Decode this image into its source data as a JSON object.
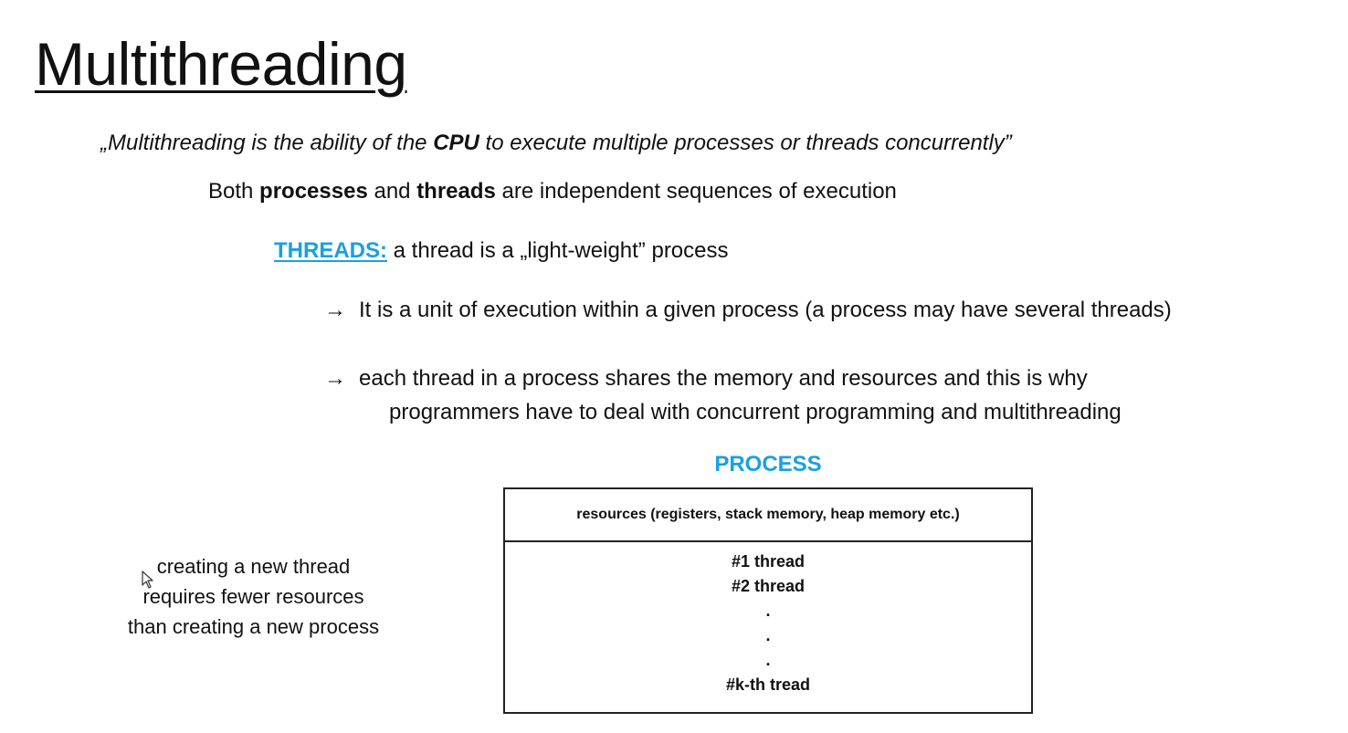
{
  "slide": {
    "title": "Multithreading",
    "quote": {
      "before": "„Multithreading is the ability of the ",
      "bold": "CPU",
      "after": " to execute multiple processes or threads concurrently”"
    },
    "both_line": {
      "part1": "Both ",
      "bold1": "processes",
      "part2": " and ",
      "bold2": "threads",
      "part3": " are independent sequences of execution"
    },
    "threads_line": {
      "label": "THREADS:",
      "text": " a thread is a „light-weight” process"
    },
    "bullets": [
      {
        "arrow": "→",
        "lines": [
          "It is a unit of execution within a given process (a process may have several threads)"
        ]
      },
      {
        "arrow": "→",
        "lines": [
          "each thread in a process shares the memory and resources and this is why",
          "programmers have to deal with concurrent programming and multithreading"
        ]
      }
    ],
    "diagram": {
      "title": "PROCESS",
      "resources": "resources (registers, stack memory, heap memory etc.)",
      "threads": [
        "#1 thread",
        "#2 thread"
      ],
      "dots": [
        ".",
        ".",
        "."
      ],
      "last_thread": "#k-th tread"
    },
    "side_note": [
      "creating a new thread",
      "requires fewer resources",
      "than creating a new process"
    ],
    "icons": {
      "cursor": "mouse-pointer-icon"
    },
    "colors": {
      "accent": "#1aa0e0",
      "text": "#111111",
      "background": "#ffffff"
    }
  }
}
